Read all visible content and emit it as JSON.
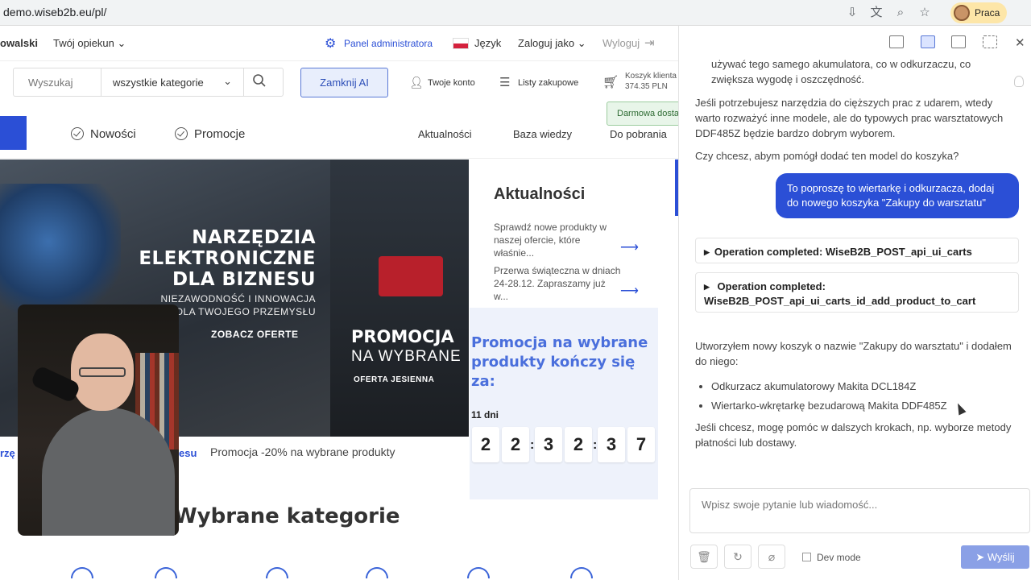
{
  "browser": {
    "url": "demo.wiseb2b.eu/pl/",
    "profile_label": "Praca"
  },
  "topnav": {
    "user_fragment": "owalski",
    "guardian": "Twój opiekun",
    "admin_panel": "Panel administratora",
    "language": "Język",
    "login_as": "Zaloguj jako",
    "logout": "Wyloguj"
  },
  "search": {
    "placeholder": "Wyszukaj",
    "category": "wszystkie kategorie"
  },
  "header": {
    "close_ai": "Zamknij AI",
    "account": "Twoje konto",
    "shopping_lists": "Listy zakupowe",
    "cart_label": "Koszyk klienta",
    "cart_amount": "374.35 PLN",
    "free_shipping": "Darmowa dostawa"
  },
  "catnav": {
    "new": "Nowości",
    "promotions": "Promocje",
    "news": "Aktualności",
    "knowledge": "Baza wiedzy",
    "downloads": "Do pobrania"
  },
  "hero": {
    "title_lines": [
      "NARZĘDZIA",
      "ELEKTRONICZNE",
      "DLA BIZNESU"
    ],
    "subtitle_lines": [
      "NIEZAWODNOŚĆ I INNOWACJA",
      "DLA TWOJEGO PRZEMYSŁU"
    ],
    "cta": "ZOBACZ OFERTE",
    "promo_title": "PROMOCJA",
    "promo_sub": "NA WYBRANE",
    "promo_small": "OFERTA JESIENNA",
    "caption_brand": "rzę",
    "caption_brand2": "esu",
    "caption": "Promocja -20% na wybrane produkty"
  },
  "news": {
    "title": "Aktualności",
    "items": [
      "Sprawdź nowe produkty w naszej ofercie, które właśnie...",
      "Przerwa świąteczna w dniach 24-28.12. Zapraszamy już w..."
    ]
  },
  "promo": {
    "title": "Promocja na wybrane produkty kończy się za:",
    "days": "11 dni",
    "digits": [
      "2",
      "2",
      "3",
      "2",
      "3",
      "7"
    ]
  },
  "categories_heading": "Wybrane kategorie",
  "chat": {
    "message_top": "używać tego samego akumulatora, co w odkurzaczu, co zwiększa wygodę i oszczędność.",
    "message_2": "Jeśli potrzebujesz narzędzia do cięższych prac z udarem, wtedy warto rozważyć inne modele, ale do typowych prac warsztatowych DDF485Z będzie bardzo dobrym wyborem.",
    "message_3": "Czy chcesz, abym pomógł dodać ten model do koszyka?",
    "user_message": "To poproszę to wiertarkę i odkurzacza, dodaj do nowego koszyka \"Zakupy do warsztatu\"",
    "op_1": "Operation completed: WiseB2B_POST_api_ui_carts",
    "op_2_line1": "Operation completed:",
    "op_2_line2": "WiseB2B_POST_api_ui_carts_id_add_product_to_cart",
    "reply": "Utworzyłem nowy koszyk o nazwie \"Zakupy do warsztatu\" i dodałem do niego:",
    "bullets": [
      "Odkurzacz akumulatorowy Makita DCL184Z",
      "Wiertarko-wkrętarkę bezudarową Makita DDF485Z"
    ],
    "closing": "Jeśli chcesz, mogę pomóc w dalszych krokach, np. wyborze metody płatności lub dostawy.",
    "input_placeholder": "Wpisz swoje pytanie lub wiadomość...",
    "dev_mode": "Dev mode",
    "send": "Wyślij"
  },
  "colors": {
    "accent": "#2b4fd6",
    "promo_text": "#4a6fdc",
    "send_button": "#8aa0e6"
  }
}
